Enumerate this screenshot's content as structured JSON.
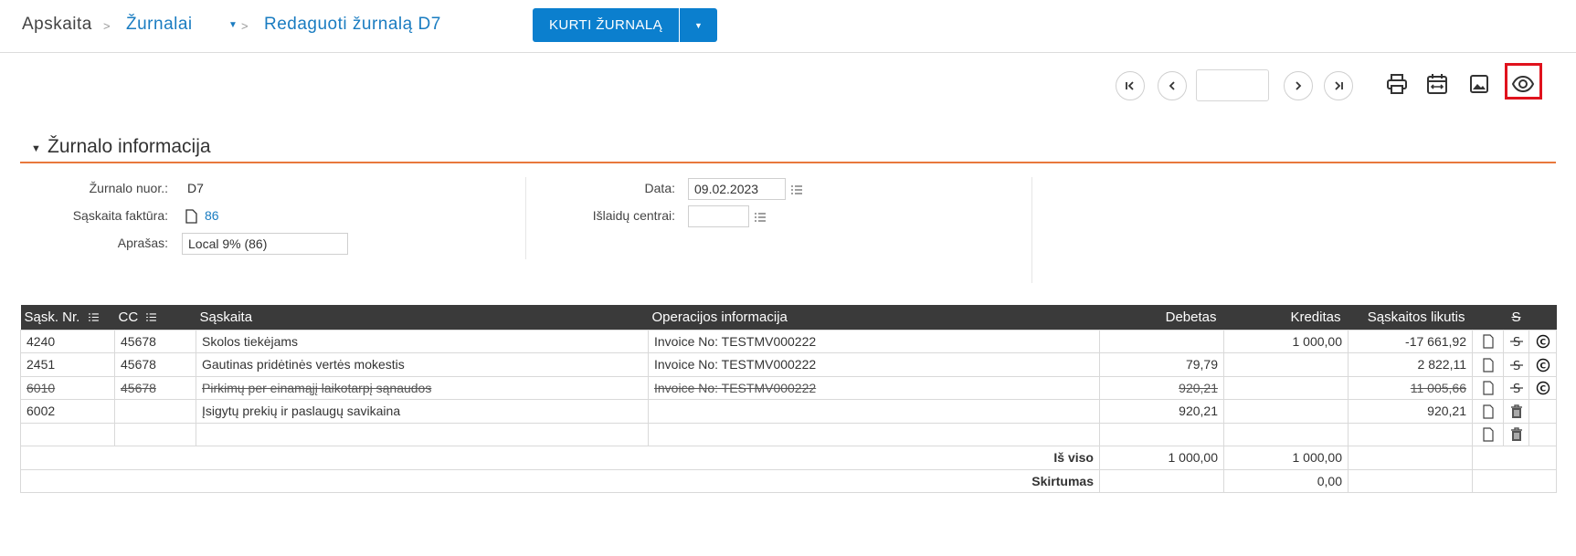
{
  "breadcrumb": {
    "root": "Apskaita",
    "separator": ">",
    "journals": "Žurnalai",
    "current": "Redaguoti žurnalą D7"
  },
  "toolbar": {
    "create_label": "KURTI ŽURNALĄ",
    "page_value": ""
  },
  "icons": {
    "first": "first-page-icon",
    "prev": "chevron-left-icon",
    "next": "chevron-right-icon",
    "last": "last-page-icon",
    "print": "print-icon",
    "calendar": "calendar-range-icon",
    "image": "image-icon",
    "preview": "eye-icon"
  },
  "colors": {
    "accent": "#0b7fce",
    "section_rule": "#e8783c",
    "table_header": "#3a3a3a",
    "highlight": "#e0121d",
    "link": "#1a7cc1"
  },
  "section": {
    "title": "Žurnalo informacija"
  },
  "form": {
    "ref_label": "Žurnalo nuor.:",
    "ref_value": "D7",
    "invoice_label": "Sąskaita faktūra:",
    "invoice_value": "86",
    "desc_label": "Aprašas:",
    "desc_value": "Local 9% (86)",
    "date_label": "Data:",
    "date_value": "09.02.2023",
    "cost_label": "Išlaidų centrai:",
    "cost_value": ""
  },
  "table": {
    "headers": {
      "acc_no": "Sąsk. Nr.",
      "cc": "CC",
      "account": "Sąskaita",
      "operation": "Operacijos informacija",
      "debit": "Debetas",
      "credit": "Kreditas",
      "balance": "Sąskaitos likutis",
      "strike": "S"
    },
    "rows": [
      {
        "acc": "4240",
        "cc": "45678",
        "account": "Skolos tiekėjams",
        "op": "Invoice No: TESTMV000222",
        "debit": "",
        "credit": "1 000,00",
        "balance": "-17 661,92",
        "struck": false,
        "kind": "strike"
      },
      {
        "acc": "2451",
        "cc": "45678",
        "account": "Gautinas pridėtinės vertės mokestis",
        "op": "Invoice No: TESTMV000222",
        "debit": "79,79",
        "credit": "",
        "balance": "2 822,11",
        "struck": false,
        "kind": "strike"
      },
      {
        "acc": "6010",
        "cc": "45678",
        "account": "Pirkimų per einamąjį laikotarpį sąnaudos",
        "op": "Invoice No: TESTMV000222",
        "debit": "920,21",
        "credit": "",
        "balance": "11 005,66",
        "struck": true,
        "kind": "strike"
      },
      {
        "acc": "6002",
        "cc": "",
        "account": "Įsigytų prekių ir paslaugų savikaina",
        "op": "",
        "debit": "920,21",
        "credit": "",
        "balance": "920,21",
        "struck": false,
        "kind": "trash"
      },
      {
        "acc": "",
        "cc": "",
        "account": "",
        "op": "",
        "debit": "",
        "credit": "",
        "balance": "",
        "struck": false,
        "kind": "trash"
      }
    ],
    "total_label": "Iš viso",
    "total_debit": "1 000,00",
    "total_credit": "1 000,00",
    "diff_label": "Skirtumas",
    "diff_credit": "0,00"
  }
}
